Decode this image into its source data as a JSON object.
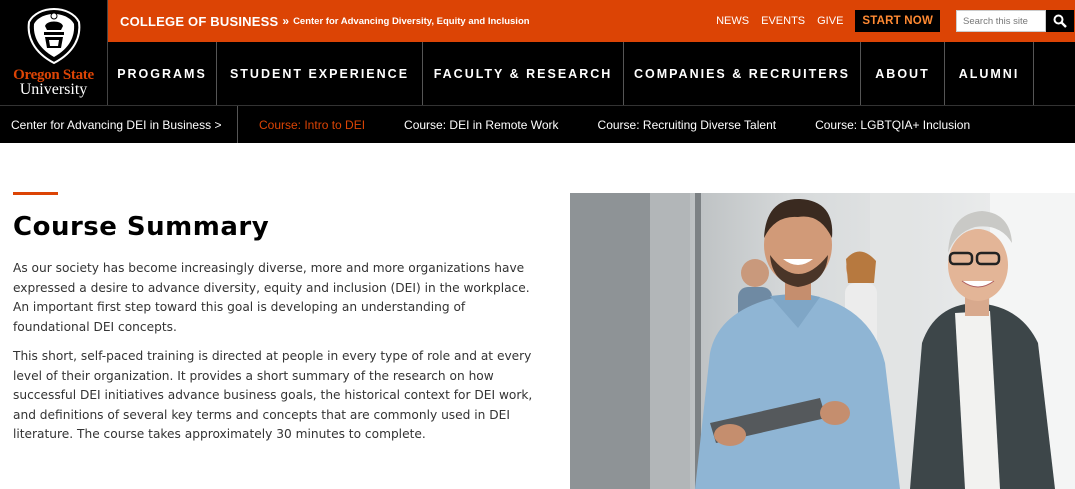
{
  "logo": {
    "line1": "Oregon State",
    "line2": "University"
  },
  "topbar": {
    "college": "COLLEGE OF BUSINESS",
    "separator": "»",
    "center": "Center for Advancing Diversity, Equity and Inclusion",
    "links": [
      "NEWS",
      "EVENTS",
      "GIVE"
    ],
    "cta": "START NOW",
    "search_placeholder": "Search this site"
  },
  "main_nav": [
    "PROGRAMS",
    "STUDENT EXPERIENCE",
    "FACULTY & RESEARCH",
    "COMPANIES & RECRUITERS",
    "ABOUT",
    "ALUMNI"
  ],
  "sub_nav": {
    "home": "Center for Advancing DEI in Business >",
    "items": [
      "Course: Intro to DEI",
      "Course: DEI in Remote Work",
      "Course: Recruiting Diverse Talent",
      "Course: LGBTQIA+ Inclusion"
    ],
    "active_index": 0
  },
  "content": {
    "heading": "Course Summary",
    "paragraph1": "As our society has become increasingly diverse, more and more organizations have expressed a desire to advance diversity, equity and inclusion (DEI) in the workplace. An important first step toward this goal is developing an understanding of foundational DEI concepts.",
    "paragraph2": "This short, self-paced training is directed at people in every type of role and at every level of their organization. It provides a short summary of the research on how successful DEI initiatives advance business goals, the historical context for DEI work, and definitions of several key terms and concepts that are commonly used in DEI literature. The course takes approximately 30 minutes to complete."
  },
  "colors": {
    "brand_orange": "#dc4405",
    "nav_black": "#000000",
    "cta_text": "#ff8a33"
  },
  "icons": {
    "search": "search-icon",
    "logo": "osu-seal-icon"
  }
}
